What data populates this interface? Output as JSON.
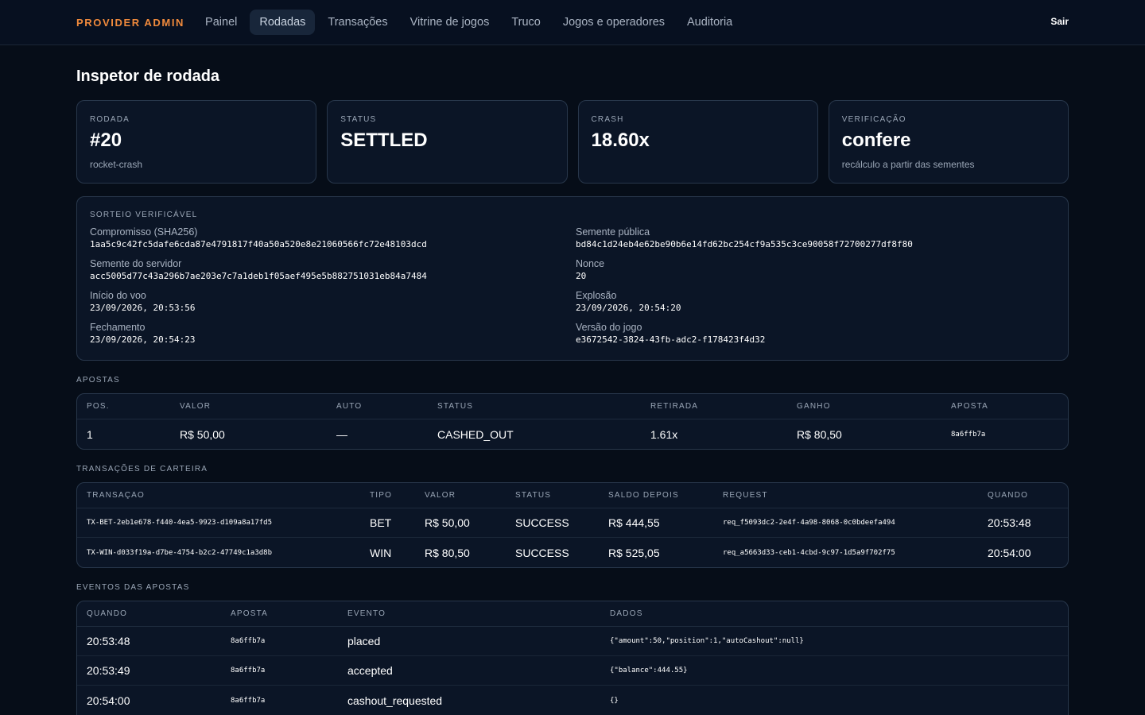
{
  "nav": {
    "brand": "PROVIDER ADMIN",
    "items": [
      "Painel",
      "Rodadas",
      "Transações",
      "Vitrine de jogos",
      "Truco",
      "Jogos e operadores",
      "Auditoria"
    ],
    "active_index": 1,
    "logout": "Sair"
  },
  "page": {
    "title": "Inspetor de rodada"
  },
  "cards": [
    {
      "label": "RODADA",
      "value": "#20",
      "sub": "rocket-crash"
    },
    {
      "label": "STATUS",
      "value": "SETTLED",
      "sub": ""
    },
    {
      "label": "CRASH",
      "value": "18.60x",
      "sub": ""
    },
    {
      "label": "VERIFICAÇÃO",
      "value": "confere",
      "sub": "recálculo a partir das sementes"
    }
  ],
  "draw": {
    "label": "SORTEIO VERIFICÁVEL",
    "items": [
      {
        "k": "Compromisso (SHA256)",
        "v": "1aa5c9c42fc5dafe6cda87e4791817f40a50a520e8e21060566fc72e48103dcd"
      },
      {
        "k": "Semente pública",
        "v": "bd84c1d24eb4e62be90b6e14fd62bc254cf9a535c3ce90058f72700277df8f80"
      },
      {
        "k": "Semente do servidor",
        "v": "acc5005d77c43a296b7ae203e7c7a1deb1f05aef495e5b882751031eb84a7484"
      },
      {
        "k": "Nonce",
        "v": "20"
      },
      {
        "k": "Início do voo",
        "v": "23/09/2026, 20:53:56"
      },
      {
        "k": "Explosão",
        "v": "23/09/2026, 20:54:20"
      },
      {
        "k": "Fechamento",
        "v": "23/09/2026, 20:54:23"
      },
      {
        "k": "Versão do jogo",
        "v": "e3672542-3824-43fb-adc2-f178423f4d32"
      }
    ]
  },
  "bets": {
    "label": "APOSTAS",
    "headers": [
      "POS.",
      "VALOR",
      "AUTO",
      "STATUS",
      "RETIRADA",
      "GANHO",
      "APOSTA"
    ],
    "rows": [
      [
        "1",
        "R$ 50,00",
        "—",
        "CASHED_OUT",
        "1.61x",
        "R$ 80,50",
        "8a6ffb7a"
      ]
    ]
  },
  "wallet": {
    "label": "TRANSAÇÕES DE CARTEIRA",
    "headers": [
      "TRANSAÇÃO",
      "TIPO",
      "VALOR",
      "STATUS",
      "SALDO DEPOIS",
      "REQUEST",
      "QUANDO"
    ],
    "rows": [
      [
        "TX-BET-2eb1e678-f440-4ea5-9923-d109a8a17fd5",
        "BET",
        "R$ 50,00",
        "SUCCESS",
        "R$ 444,55",
        "req_f5093dc2-2e4f-4a98-8068-0c0bdeefa494",
        "20:53:48"
      ],
      [
        "TX-WIN-d033f19a-d7be-4754-b2c2-47749c1a3d8b",
        "WIN",
        "R$ 80,50",
        "SUCCESS",
        "R$ 525,05",
        "req_a5663d33-ceb1-4cbd-9c97-1d5a9f702f75",
        "20:54:00"
      ]
    ]
  },
  "events": {
    "label": "EVENTOS DAS APOSTAS",
    "headers": [
      "QUANDO",
      "APOSTA",
      "EVENTO",
      "DADOS"
    ],
    "rows": [
      [
        "20:53:48",
        "8a6ffb7a",
        "placed",
        "{\"amount\":50,\"position\":1,\"autoCashout\":null}"
      ],
      [
        "20:53:49",
        "8a6ffb7a",
        "accepted",
        "{\"balance\":444.55}"
      ],
      [
        "20:54:00",
        "8a6ffb7a",
        "cashout_requested",
        "{}"
      ]
    ]
  }
}
